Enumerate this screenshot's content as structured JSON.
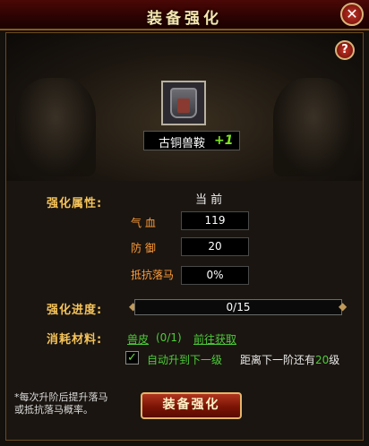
{
  "window": {
    "title": "装备强化",
    "close_glyph": "✕"
  },
  "help": {
    "glyph": "?"
  },
  "item": {
    "name": "古铜兽鞍",
    "plus": "+1",
    "icon": "saddle-icon"
  },
  "attributes": {
    "label": "强化属性:",
    "current_header": "当 前",
    "rows": [
      {
        "name": "气 血",
        "value": "119"
      },
      {
        "name": "防 御",
        "value": "20"
      },
      {
        "name": "抵抗落马",
        "value": "0%"
      }
    ]
  },
  "progress": {
    "label": "强化进度:",
    "text": "0/15",
    "current": 0,
    "max": 15
  },
  "materials": {
    "label": "消耗材料:",
    "item": "兽皮",
    "count": "(0/1)",
    "link": "前往获取",
    "auto_upgrade_label": "自动升到下一级",
    "auto_upgrade_checked": true,
    "next_level_text": "距离下一阶还有",
    "next_level_value": "20",
    "next_level_suffix": "级"
  },
  "note": {
    "line1": "*每次升阶后提升落马",
    "line2": "或抵抗落马概率。"
  },
  "action": {
    "button_label": "装备强化"
  },
  "colors": {
    "accent_gold": "#f5c35a",
    "link_green": "#4ecb3a",
    "plus_green": "#7ce81c",
    "title_red": "#4a0805"
  }
}
